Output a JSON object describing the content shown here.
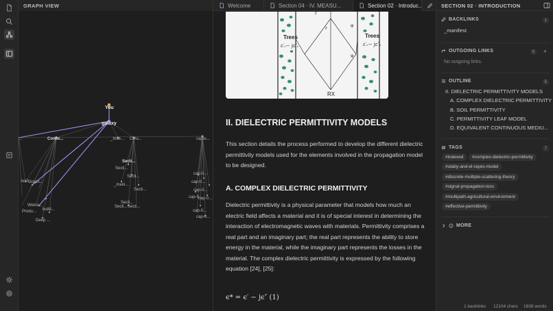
{
  "graph": {
    "title": "GRAPH VIEW"
  },
  "graph_labels": {
    "you": "You",
    "galaxy": "galaxy",
    "left_trunc": "...",
    "conce": "Conce...",
    "index": "_Inde...",
    "citru": "Citru...",
    "captu": "captu...",
    "secti_main": "Secti...",
    "secti_a": "Secti...",
    "secti_b": "Secti...",
    "mani": "_mani...",
    "secti_c": "Secti...",
    "secti_d": "Secti...",
    "secti_e": "Secti...",
    "secti_f": "Secti...",
    "arch": "Arch...",
    "graph": "Graph...",
    "welco": "Welco...",
    "produ": "Produ...",
    "build": "build...",
    "deep": "Deep ...",
    "cap1": "cap-0...",
    "cap2": "cap-0...",
    "cap3": "cap-0...",
    "cap4": "cap-0...",
    "cap5": "cap-0...",
    "cap6": "cap-0...",
    "cap7": "cap-0..."
  },
  "tabs": [
    {
      "label": "Welcome"
    },
    {
      "label": "Section 04 · IV. MEASU..."
    },
    {
      "label": "Section 02 · Introduc..."
    }
  ],
  "figure": {
    "label_trees_left": "Trees",
    "label_trees_right": "Trees",
    "label_eps_left": "ε′ᵣ− jε″ᵣ",
    "label_eps_right": "ε′ᵣ− jε″ᵣ",
    "label_rx": "RX",
    "label_r": "r",
    "label_rd": "r",
    "label_phi1": "φ",
    "label_phi2": "φ"
  },
  "doc": {
    "h2": "II. DIELECTRIC PERMITTIVITY MODELS",
    "p1": "This section details the process performed to develop the different dielectric permittivity models used for the elements involved in the propagation model to be designed.",
    "h3": "A. COMPLEX DIELECTRIC PERMITTIVITY",
    "p2": "Dielectric permittivity is a physical parameter that models how much an electric field affects a material and it is of special interest in determining the interaction of electromagnetic waves with materials. Permittivity comprises a real part and an imaginary part; the real part represents the ability to store energy in the material, while the imaginary part represents the losses in the material. The complex dielectric permittivity is expressed by the following equation [24], [25]:",
    "equation": "ϵ* = ϵ′ − jϵ″    (1)"
  },
  "right": {
    "title": "SECTION 02 · INTRODUCTION",
    "backlinks": {
      "label": "BACKLINKS",
      "count": "1",
      "items": [
        "_manifest"
      ]
    },
    "outgoing": {
      "label": "OUTGOING LINKS",
      "count": "0",
      "empty": "No outgoing links."
    },
    "outline": {
      "label": "OUTLINE",
      "count": "5",
      "items": [
        "II. DIELECTRIC PERMITTIVITY MODELS",
        "A. COMPLEX DIELECTRIC PERMITTIVITY",
        "B. SOIL PERMITTIVITY",
        "C. PERMITTIVITY LEAF MODEL",
        "D. EQUIVALENT CONTINUOUS MEDIU..."
      ]
    },
    "tags": {
      "label": "TAGS",
      "count": "7",
      "items": [
        "#indexed",
        "#complex-dielectric-permittivity",
        "#ulaby-and-el-rayes-model",
        "#discrete-multiple-scattering-theory",
        "#signal-propagation-loss",
        "#multipath-agricultural-environment",
        "#effective-permittivity"
      ]
    },
    "more": "MORE"
  },
  "status": {
    "backlinks": "1 backlinks",
    "chars": "12104 chars",
    "words": "1838 words"
  },
  "colors": {
    "accent": "#a48cf0",
    "you_node": "#e0b341",
    "tree_dots": "#3a8f6a"
  }
}
